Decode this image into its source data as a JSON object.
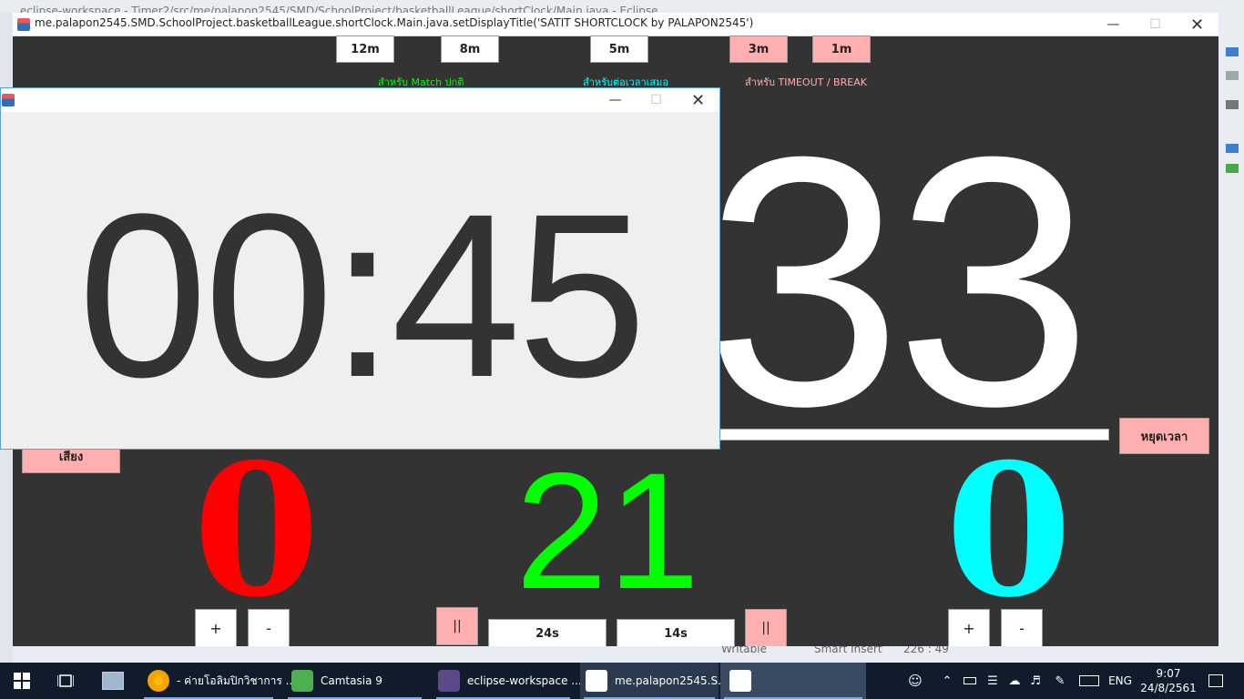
{
  "eclipse": {
    "title": "eclipse-workspace - Timer2/src/me/palapon2545/SMD/SchoolProject/basketballLeague/shortClock/Main.java - Eclipse",
    "status": {
      "writable": "Writable",
      "insert_mode": "Smart Insert",
      "position": "226 : 49"
    }
  },
  "main_window": {
    "title": "me.palapon2545.SMD.SchoolProject.basketballLeague.shortClock.Main.java.setDisplayTitle('SATIT SHORTCLOCK by PALAPON2545')",
    "preset_buttons": [
      "12m",
      "8m",
      "5m",
      "3m",
      "1m"
    ],
    "captions": {
      "match": "สำหรับ Match ปกติ",
      "overtime": "สำหรับต่อเวลาเสมอ",
      "timeout": "สำหรับ TIMEOUT / BREAK"
    },
    "main_number": "33",
    "progress_fraction": 1.0,
    "stop_button": "หยุดเวลา",
    "sound_button": "เสียง",
    "score_left": "0",
    "score_right": "0",
    "shot_clock": "21",
    "plus_label": "+",
    "minus_label": "-",
    "pause_label": "||",
    "reset_24": "24s",
    "reset_14": "14s",
    "colors": {
      "left_team": "#ff0000",
      "right_team": "#00ffff",
      "shot_clock": "#00ff00",
      "background": "#333333",
      "pink_button": "#ffafaf"
    }
  },
  "popup_window": {
    "time": "00:45"
  },
  "taskbar": {
    "apps": [
      {
        "label": "- ค่ายโอลิมปิกวิชาการ ...",
        "icon": "chrome-icon"
      },
      {
        "label": "Camtasia 9",
        "icon": "camtasia-icon"
      },
      {
        "label": "eclipse-workspace ...",
        "icon": "eclipse-icon"
      },
      {
        "label": "me.palapon2545.S...",
        "icon": "java-icon"
      }
    ],
    "language": "ENG",
    "time": "9:07",
    "date": "24/8/2561"
  }
}
